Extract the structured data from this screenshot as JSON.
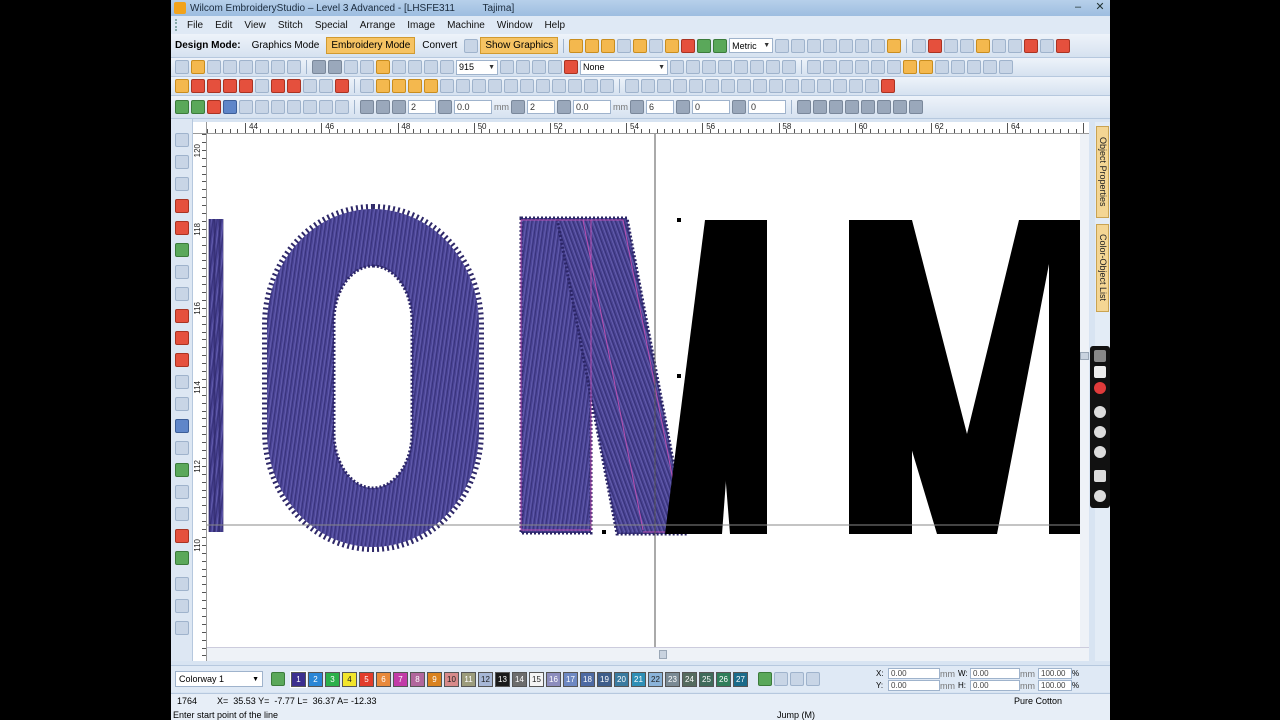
{
  "window": {
    "title": "Wilcom EmbroideryStudio – Level 3 Advanced - [LHSFE311          Tajima]",
    "minimize": "–",
    "close": "✕"
  },
  "menu": [
    "File",
    "Edit",
    "View",
    "Stitch",
    "Special",
    "Arrange",
    "Image",
    "Machine",
    "Window",
    "Help"
  ],
  "toolbar": {
    "design_mode_label": "Design Mode:",
    "graphics_mode": "Graphics Mode",
    "embroidery_mode": "Embroidery Mode",
    "convert": "Convert",
    "show_graphics": "Show Graphics",
    "units": "Metric",
    "zoom_value": "915",
    "fabric": "None",
    "field_values": [
      "2",
      "0.0",
      "2",
      "0.0",
      "6",
      "0",
      "0"
    ],
    "unit_mm": "mm"
  },
  "rulers": {
    "top_labels": [
      "44",
      "46",
      "48",
      "50",
      "52",
      "54",
      "56",
      "58",
      "60",
      "62",
      "64"
    ],
    "left_labels": [
      "120",
      "118",
      "116",
      "114",
      "112",
      "110"
    ]
  },
  "side_tabs": {
    "object_properties": "Object Properties",
    "color_object_list": "Color-Object List"
  },
  "colorbar": {
    "colorway": "Colorway 1",
    "swatches": [
      {
        "n": "1",
        "color": "#3c2f8f"
      },
      {
        "n": "2",
        "color": "#2a86d6"
      },
      {
        "n": "3",
        "color": "#2bb04a"
      },
      {
        "n": "4",
        "color": "#f2e52c"
      },
      {
        "n": "5",
        "color": "#e23c2b"
      },
      {
        "n": "6",
        "color": "#e8893b"
      },
      {
        "n": "7",
        "color": "#c23ca8"
      },
      {
        "n": "8",
        "color": "#b1669c"
      },
      {
        "n": "9",
        "color": "#d9821f"
      },
      {
        "n": "10",
        "color": "#d78a8a"
      },
      {
        "n": "11",
        "color": "#9c9c7c"
      },
      {
        "n": "12",
        "color": "#a7b7d6"
      },
      {
        "n": "13",
        "color": "#1a1a1a"
      },
      {
        "n": "14",
        "color": "#6d6d6d"
      },
      {
        "n": "15",
        "color": "#f4f4f4"
      },
      {
        "n": "16",
        "color": "#8d8dbd"
      },
      {
        "n": "17",
        "color": "#6d88c2"
      },
      {
        "n": "18",
        "color": "#4d6aa3"
      },
      {
        "n": "19",
        "color": "#3e5d8a"
      },
      {
        "n": "20",
        "color": "#3a7ba0"
      },
      {
        "n": "21",
        "color": "#2e8fb6"
      },
      {
        "n": "22",
        "color": "#8ab3d9"
      },
      {
        "n": "23",
        "color": "#7a8a94"
      },
      {
        "n": "24",
        "color": "#556b5f"
      },
      {
        "n": "25",
        "color": "#3f6b5b"
      },
      {
        "n": "26",
        "color": "#2f7e5a"
      },
      {
        "n": "27",
        "color": "#1b6b8a"
      }
    ],
    "x_label": "X:",
    "x_value": "0.00",
    "y_label": "Y:",
    "y_value": "0.00",
    "w_label": "W:",
    "w_value": "0.00",
    "h_label": "H:",
    "h_value": "0.00",
    "unit": "mm",
    "pct_w": "100.00",
    "pct_h": "100.00",
    "pct": "%"
  },
  "status": {
    "stitch_count": "1764",
    "coords": "X=  35.53 Y=  -7.77 L=  36.37 A= -12.33",
    "prompt": "Enter start point of the line",
    "stitch_type": "Jump (M)",
    "thread": "Pure Cotton"
  },
  "colors": {
    "accent_orange": "#f6c363",
    "thread_purple": "#4b4597",
    "artwork_black": "#000000"
  }
}
